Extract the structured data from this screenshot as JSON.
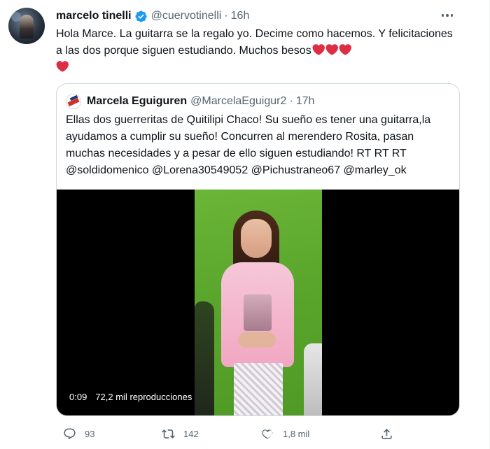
{
  "tweet": {
    "author_name": "marcelo tinelli",
    "author_handle": "@cuervotinelli",
    "separator": "·",
    "time": "16h",
    "text": "Hola Marce. La guitarra se la regalo yo. Decime como hacemos. Y felicitaciones a las dos porque siguen estudiando. Muchos besos",
    "emoji": [
      "red-heart",
      "red-heart",
      "red-heart",
      "red-heart"
    ],
    "verified": true
  },
  "quoted": {
    "author_name": "Marcela Eguiguren",
    "author_handle": "@MarcelaEguigur2",
    "separator": "·",
    "time": "17h",
    "text": "Ellas dos guerreritas de Quitilipi Chaco! Su sueño es tener una guitarra,la ayudamos a cumplir su sueño! Concurren al merendero Rosita, pasan muchas necesidades y a pesar de ello siguen estudiando! RT RT RT @soldidomenico @Lorena30549052 @Pichustraneo67 @marley_ok",
    "video": {
      "duration": "0:09",
      "views": "72,2 mil reproducciones"
    }
  },
  "actions": {
    "reply_count": "93",
    "retweet_count": "142",
    "like_count": "1,8 mil",
    "share_count": ""
  },
  "colors": {
    "verified_blue": "#1d9bf0",
    "heart_red": "#dd2e44",
    "secondary_text": "#536471",
    "border": "#cfd9de"
  },
  "icons": [
    "more-icon",
    "verified-icon",
    "reply-icon",
    "retweet-icon",
    "like-icon",
    "share-icon",
    "heart-emoji-icon"
  ]
}
